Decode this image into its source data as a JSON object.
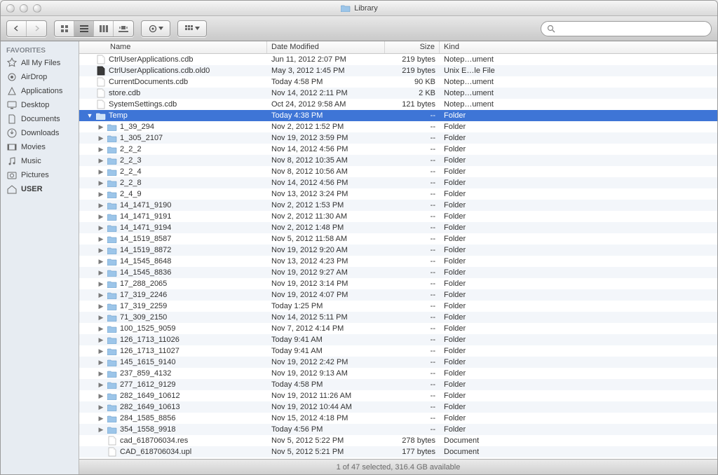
{
  "window_title": "Library",
  "sidebar": {
    "heading": "FAVORITES",
    "items": [
      {
        "label": "All My Files",
        "icon": "star-icon"
      },
      {
        "label": "AirDrop",
        "icon": "airdrop-icon"
      },
      {
        "label": "Applications",
        "icon": "applications-icon"
      },
      {
        "label": "Desktop",
        "icon": "desktop-icon"
      },
      {
        "label": "Documents",
        "icon": "documents-icon"
      },
      {
        "label": "Downloads",
        "icon": "downloads-icon"
      },
      {
        "label": "Movies",
        "icon": "movies-icon"
      },
      {
        "label": "Music",
        "icon": "music-icon"
      },
      {
        "label": "Pictures",
        "icon": "pictures-icon"
      },
      {
        "label": "USER",
        "icon": "home-icon",
        "bold": true
      }
    ]
  },
  "columns": {
    "name": "Name",
    "date": "Date Modified",
    "size": "Size",
    "kind": "Kind"
  },
  "rows": [
    {
      "depth": 1,
      "icon": "file",
      "name": "CtrlUserApplications.cdb",
      "date": "Jun 11, 2012 2:07 PM",
      "size": "219 bytes",
      "kind": "Notep…ument"
    },
    {
      "depth": 1,
      "icon": "file-dark",
      "name": "CtrlUserApplications.cdb.old0",
      "date": "May 3, 2012 1:45 PM",
      "size": "219 bytes",
      "kind": "Unix E…le File"
    },
    {
      "depth": 1,
      "icon": "file",
      "name": "CurrentDocuments.cdb",
      "date": "Today 4:58 PM",
      "size": "90 KB",
      "kind": "Notep…ument"
    },
    {
      "depth": 1,
      "icon": "file",
      "name": "store.cdb",
      "date": "Nov 14, 2012 2:11 PM",
      "size": "2 KB",
      "kind": "Notep…ument"
    },
    {
      "depth": 1,
      "icon": "file",
      "name": "SystemSettings.cdb",
      "date": "Oct 24, 2012 9:58 AM",
      "size": "121 bytes",
      "kind": "Notep…ument"
    },
    {
      "depth": 1,
      "icon": "folder",
      "name": "Temp",
      "date": "Today 4:38 PM",
      "size": "--",
      "kind": "Folder",
      "selected": true,
      "expanded": true
    },
    {
      "depth": 2,
      "icon": "folder",
      "name": "1_39_294",
      "date": "Nov 2, 2012 1:52 PM",
      "size": "--",
      "kind": "Folder",
      "expandable": true
    },
    {
      "depth": 2,
      "icon": "folder",
      "name": "1_305_2107",
      "date": "Nov 19, 2012 3:59 PM",
      "size": "--",
      "kind": "Folder",
      "expandable": true
    },
    {
      "depth": 2,
      "icon": "folder",
      "name": "2_2_2",
      "date": "Nov 14, 2012 4:56 PM",
      "size": "--",
      "kind": "Folder",
      "expandable": true
    },
    {
      "depth": 2,
      "icon": "folder",
      "name": "2_2_3",
      "date": "Nov 8, 2012 10:35 AM",
      "size": "--",
      "kind": "Folder",
      "expandable": true
    },
    {
      "depth": 2,
      "icon": "folder",
      "name": "2_2_4",
      "date": "Nov 8, 2012 10:56 AM",
      "size": "--",
      "kind": "Folder",
      "expandable": true
    },
    {
      "depth": 2,
      "icon": "folder",
      "name": "2_2_8",
      "date": "Nov 14, 2012 4:56 PM",
      "size": "--",
      "kind": "Folder",
      "expandable": true
    },
    {
      "depth": 2,
      "icon": "folder",
      "name": "2_4_9",
      "date": "Nov 13, 2012 3:24 PM",
      "size": "--",
      "kind": "Folder",
      "expandable": true
    },
    {
      "depth": 2,
      "icon": "folder",
      "name": "14_1471_9190",
      "date": "Nov 2, 2012 1:53 PM",
      "size": "--",
      "kind": "Folder",
      "expandable": true
    },
    {
      "depth": 2,
      "icon": "folder",
      "name": "14_1471_9191",
      "date": "Nov 2, 2012 11:30 AM",
      "size": "--",
      "kind": "Folder",
      "expandable": true
    },
    {
      "depth": 2,
      "icon": "folder",
      "name": "14_1471_9194",
      "date": "Nov 2, 2012 1:48 PM",
      "size": "--",
      "kind": "Folder",
      "expandable": true
    },
    {
      "depth": 2,
      "icon": "folder",
      "name": "14_1519_8587",
      "date": "Nov 5, 2012 11:58 AM",
      "size": "--",
      "kind": "Folder",
      "expandable": true
    },
    {
      "depth": 2,
      "icon": "folder",
      "name": "14_1519_8872",
      "date": "Nov 19, 2012 9:20 AM",
      "size": "--",
      "kind": "Folder",
      "expandable": true
    },
    {
      "depth": 2,
      "icon": "folder",
      "name": "14_1545_8648",
      "date": "Nov 13, 2012 4:23 PM",
      "size": "--",
      "kind": "Folder",
      "expandable": true
    },
    {
      "depth": 2,
      "icon": "folder",
      "name": "14_1545_8836",
      "date": "Nov 19, 2012 9:27 AM",
      "size": "--",
      "kind": "Folder",
      "expandable": true
    },
    {
      "depth": 2,
      "icon": "folder",
      "name": "17_288_2065",
      "date": "Nov 19, 2012 3:14 PM",
      "size": "--",
      "kind": "Folder",
      "expandable": true
    },
    {
      "depth": 2,
      "icon": "folder",
      "name": "17_319_2246",
      "date": "Nov 19, 2012 4:07 PM",
      "size": "--",
      "kind": "Folder",
      "expandable": true
    },
    {
      "depth": 2,
      "icon": "folder",
      "name": "17_319_2259",
      "date": "Today 1:25 PM",
      "size": "--",
      "kind": "Folder",
      "expandable": true
    },
    {
      "depth": 2,
      "icon": "folder",
      "name": "71_309_2150",
      "date": "Nov 14, 2012 5:11 PM",
      "size": "--",
      "kind": "Folder",
      "expandable": true
    },
    {
      "depth": 2,
      "icon": "folder",
      "name": "100_1525_9059",
      "date": "Nov 7, 2012 4:14 PM",
      "size": "--",
      "kind": "Folder",
      "expandable": true
    },
    {
      "depth": 2,
      "icon": "folder",
      "name": "126_1713_11026",
      "date": "Today 9:41 AM",
      "size": "--",
      "kind": "Folder",
      "expandable": true
    },
    {
      "depth": 2,
      "icon": "folder",
      "name": "126_1713_11027",
      "date": "Today 9:41 AM",
      "size": "--",
      "kind": "Folder",
      "expandable": true
    },
    {
      "depth": 2,
      "icon": "folder",
      "name": "145_1615_9140",
      "date": "Nov 19, 2012 2:42 PM",
      "size": "--",
      "kind": "Folder",
      "expandable": true
    },
    {
      "depth": 2,
      "icon": "folder",
      "name": "237_859_4132",
      "date": "Nov 19, 2012 9:13 AM",
      "size": "--",
      "kind": "Folder",
      "expandable": true
    },
    {
      "depth": 2,
      "icon": "folder",
      "name": "277_1612_9129",
      "date": "Today 4:58 PM",
      "size": "--",
      "kind": "Folder",
      "expandable": true
    },
    {
      "depth": 2,
      "icon": "folder",
      "name": "282_1649_10612",
      "date": "Nov 19, 2012 11:26 AM",
      "size": "--",
      "kind": "Folder",
      "expandable": true
    },
    {
      "depth": 2,
      "icon": "folder",
      "name": "282_1649_10613",
      "date": "Nov 19, 2012 10:44 AM",
      "size": "--",
      "kind": "Folder",
      "expandable": true
    },
    {
      "depth": 2,
      "icon": "folder",
      "name": "284_1585_8856",
      "date": "Nov 15, 2012 4:18 PM",
      "size": "--",
      "kind": "Folder",
      "expandable": true
    },
    {
      "depth": 2,
      "icon": "folder",
      "name": "354_1558_9918",
      "date": "Today 4:56 PM",
      "size": "--",
      "kind": "Folder",
      "expandable": true
    },
    {
      "depth": 2,
      "icon": "file",
      "name": "cad_618706034.res",
      "date": "Nov 5, 2012 5:22 PM",
      "size": "278 bytes",
      "kind": "Document"
    },
    {
      "depth": 2,
      "icon": "file",
      "name": "CAD_618706034.upl",
      "date": "Nov 5, 2012 5:21 PM",
      "size": "177 bytes",
      "kind": "Document"
    }
  ],
  "status": "1 of 47 selected, 316.4 GB available",
  "search_placeholder": ""
}
